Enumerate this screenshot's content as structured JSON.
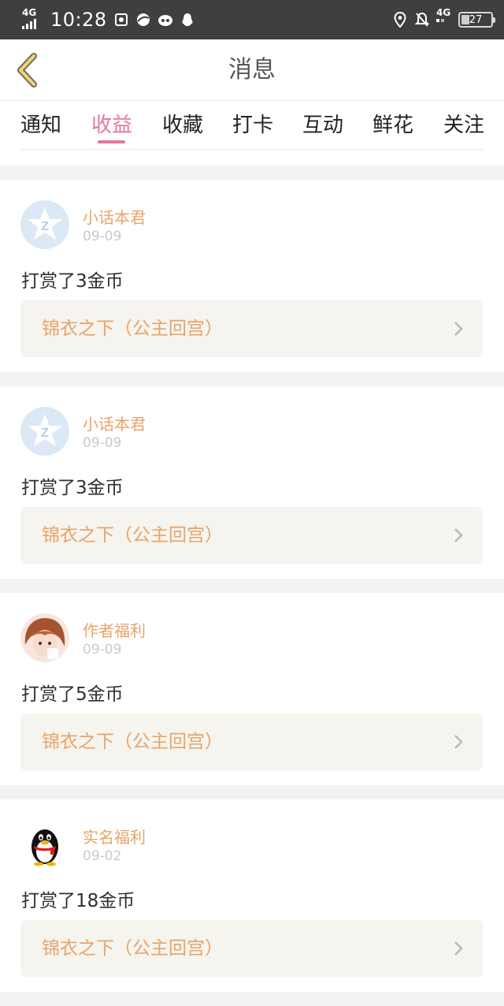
{
  "status_bar": {
    "network_left": "4G",
    "time": "10:28",
    "network_right": "4G",
    "battery": "27"
  },
  "header": {
    "title": "消息",
    "back_icon": "chevron-left-icon"
  },
  "tabs": [
    {
      "label": "通知",
      "active": false
    },
    {
      "label": "收益",
      "active": true
    },
    {
      "label": "收藏",
      "active": false
    },
    {
      "label": "打卡",
      "active": false
    },
    {
      "label": "互动",
      "active": false
    },
    {
      "label": "鲜花",
      "active": false
    },
    {
      "label": "关注",
      "active": false
    }
  ],
  "colors": {
    "accent": "#e2769f",
    "username": "#e8a469",
    "book_bg": "#f5f4ee"
  },
  "messages": [
    {
      "avatar": "qzone-star-avatar",
      "username": "小话本君",
      "date": "09-09",
      "text": "打赏了3金币",
      "book": "锦衣之下（公主回宫）"
    },
    {
      "avatar": "qzone-star-avatar",
      "username": "小话本君",
      "date": "09-09",
      "text": "打赏了3金币",
      "book": "锦衣之下（公主回宫）"
    },
    {
      "avatar": "anime-girl-avatar",
      "username": "作者福利",
      "date": "09-09",
      "text": "打赏了5金币",
      "book": "锦衣之下（公主回宫）"
    },
    {
      "avatar": "qq-penguin-avatar",
      "username": "实名福利",
      "date": "09-02",
      "text": "打赏了18金币",
      "book": "锦衣之下（公主回宫）"
    }
  ]
}
